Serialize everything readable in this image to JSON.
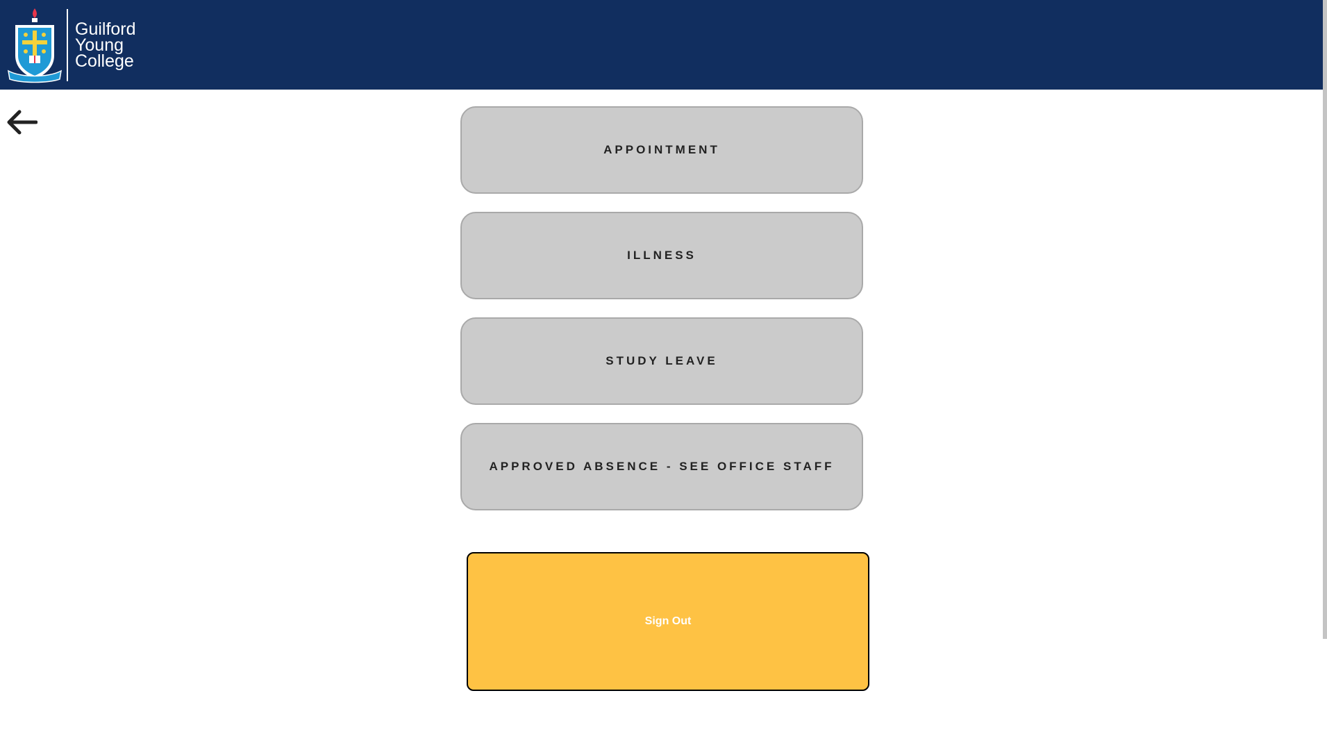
{
  "header": {
    "logo_lines": [
      "Guilford",
      "Young",
      "College"
    ],
    "crest_icon": "school-crest-icon",
    "background_color": "#112e5f"
  },
  "nav": {
    "back_icon": "arrow-left-icon"
  },
  "reasons": {
    "items": [
      {
        "label": "APPOINTMENT"
      },
      {
        "label": "ILLNESS"
      },
      {
        "label": "STUDY LEAVE"
      },
      {
        "label": "APPROVED ABSENCE - SEE OFFICE STAFF"
      }
    ],
    "button_color": "#cbcbcb"
  },
  "signout": {
    "label": "Sign Out",
    "color": "#fec244"
  }
}
